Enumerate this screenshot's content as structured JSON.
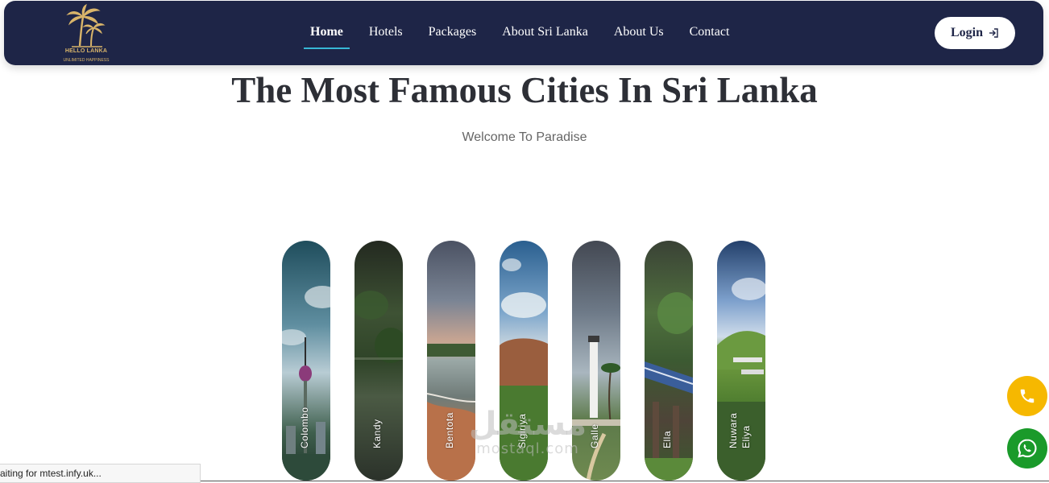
{
  "brand": {
    "name": "HELLO LANKA",
    "tagline": "UNLIMITED HAPPINESS",
    "logo_icon": "palm-trees-icon",
    "color": "#d9b56a"
  },
  "nav": {
    "items": [
      {
        "label": "Home",
        "active": true
      },
      {
        "label": "Hotels",
        "active": false
      },
      {
        "label": "Packages",
        "active": false
      },
      {
        "label": "About Sri Lanka",
        "active": false
      },
      {
        "label": "About Us",
        "active": false
      },
      {
        "label": "Contact",
        "active": false
      }
    ],
    "login_label": "Login",
    "login_icon": "login-arrow-icon",
    "background": "#1e2547",
    "active_underline": "#37b7d6"
  },
  "hero": {
    "title": "The Most Famous Cities In Sri Lanka",
    "subtitle": "Welcome To Paradise"
  },
  "cities": [
    {
      "name": "Colombo"
    },
    {
      "name": "Kandy"
    },
    {
      "name": "Bentota"
    },
    {
      "name": "Sigiriya"
    },
    {
      "name": "Galle"
    },
    {
      "name": "Ella"
    },
    {
      "name": "Nuwara Eliya",
      "line1": "Nuwara",
      "line2": "Eliya"
    }
  ],
  "floating": {
    "phone_icon": "phone-icon",
    "phone_color": "#f6b800",
    "whatsapp_icon": "whatsapp-icon",
    "whatsapp_color": "#1a9a2a"
  },
  "watermark": {
    "arabic": "مستقل",
    "latin": "mostaql.com"
  },
  "status_bar": {
    "text": "aiting for mtest.infy.uk..."
  }
}
